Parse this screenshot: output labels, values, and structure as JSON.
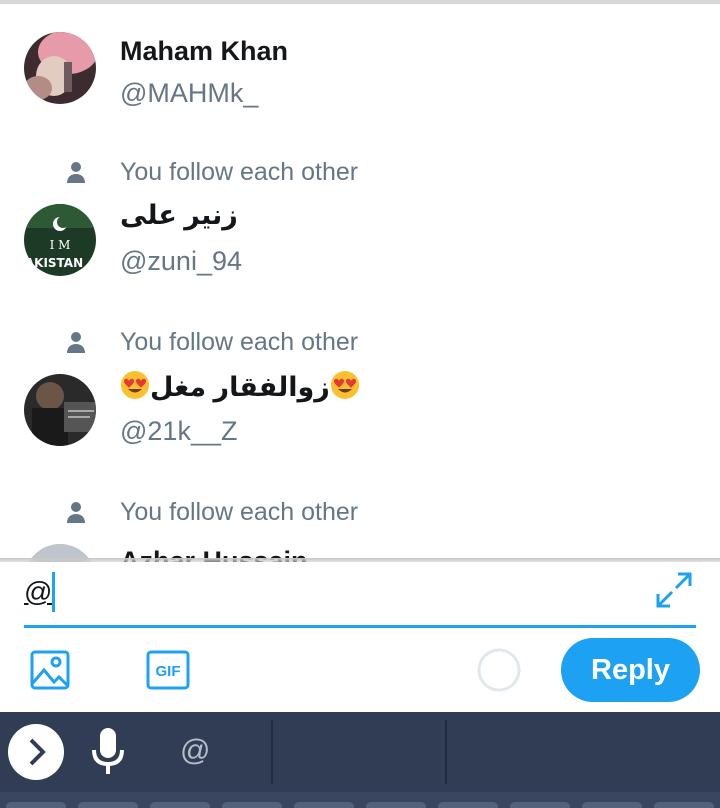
{
  "suggestions": [
    {
      "name": "Maham Khan",
      "handle": "@MAHMk_",
      "follow_note": ""
    },
    {
      "name": "زنیر علی",
      "handle": "@zuni_94",
      "follow_note": "You follow each other"
    },
    {
      "name": "زوالفقار مغل",
      "handle": "@21k__Z",
      "follow_note": "You follow each other"
    },
    {
      "name": "Azhar Hussain",
      "handle": "",
      "follow_note": "You follow each other"
    }
  ],
  "avatar2_text": {
    "line1": "I M",
    "line2": "AKISTAN"
  },
  "compose": {
    "text": "@"
  },
  "toolbar": {
    "reply_label": "Reply",
    "gif_label": "GIF"
  },
  "keyboard": {
    "suggestion": "@"
  },
  "colors": {
    "accent": "#1da1f2",
    "keyboard_bg": "#313d54",
    "muted_text": "#657786"
  },
  "icons": [
    "person-icon",
    "expand-icon",
    "image-icon",
    "gif-icon",
    "progress-ring-icon",
    "chevron-right-icon",
    "microphone-icon",
    "heart-eyes-emoji"
  ]
}
